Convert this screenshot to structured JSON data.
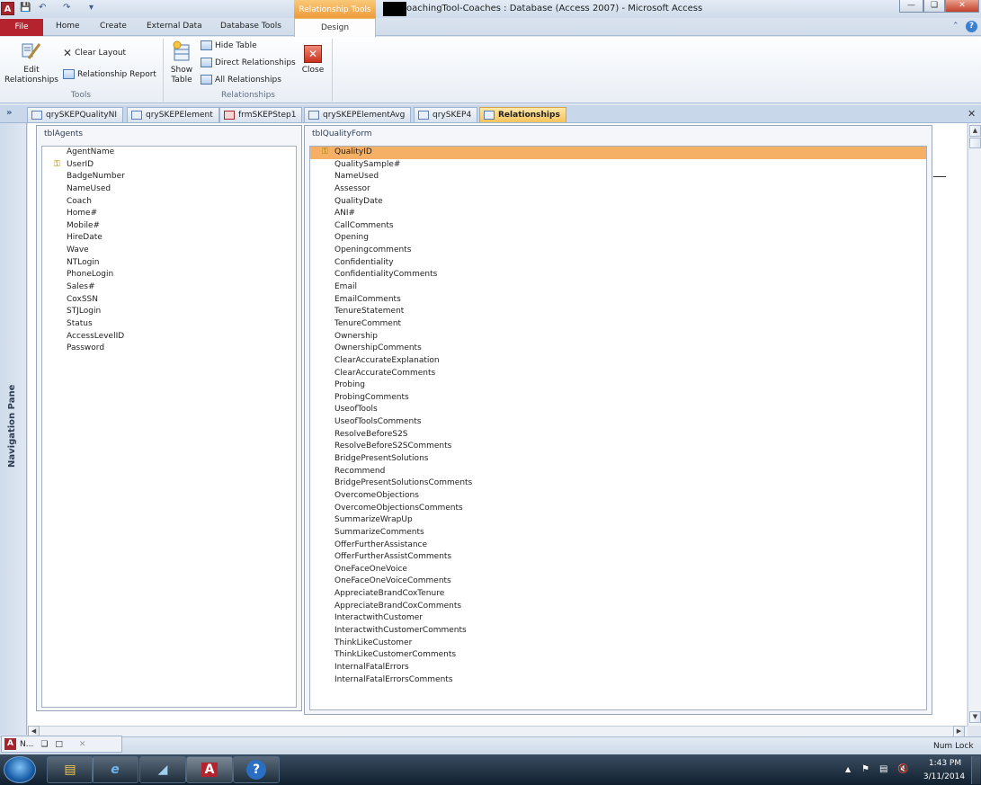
{
  "window": {
    "title": "oachingTool-Coaches : Database (Access 2007)  -  Microsoft Access",
    "context_tab_header": "Relationship Tools"
  },
  "ribbon_tabs": {
    "file": "File",
    "home": "Home",
    "create": "Create",
    "external_data": "External Data",
    "database_tools": "Database Tools",
    "design": "Design"
  },
  "ribbon": {
    "tools_group": {
      "label": "Tools",
      "edit_relationships": "Edit\nRelationships",
      "clear_layout": "Clear Layout",
      "relationship_report": "Relationship Report"
    },
    "relationships_group": {
      "label": "Relationships",
      "show_table": "Show\nTable",
      "hide_table": "Hide Table",
      "direct_relationships": "Direct Relationships",
      "all_relationships": "All Relationships",
      "close": "Close"
    }
  },
  "document_tabs": [
    {
      "label": "qrySKEPQualityNI",
      "icon": "query-icon"
    },
    {
      "label": "qrySKEPElement",
      "icon": "query-icon"
    },
    {
      "label": "frmSKEPStep1",
      "icon": "form-icon"
    },
    {
      "label": "qrySKEPElementAvg",
      "icon": "query-icon"
    },
    {
      "label": "qrySKEP4",
      "icon": "query-icon"
    },
    {
      "label": "Relationships",
      "icon": "relationships-icon",
      "active": true
    }
  ],
  "nav_pane": {
    "label": "Navigation Pane",
    "toggle": "»"
  },
  "tables": {
    "agents": {
      "name": "tblAgents",
      "fields": [
        "AgentName",
        "UserID",
        "BadgeNumber",
        "NameUsed",
        "Coach",
        "Home#",
        "Mobile#",
        "HireDate",
        "Wave",
        "NTLogin",
        "PhoneLogin",
        "Sales#",
        "CoxSSN",
        "STJLogin",
        "Status",
        "AccessLevelID",
        "Password"
      ],
      "key_field": "UserID"
    },
    "quality_form": {
      "name": "tblQualityForm",
      "fields": [
        "QualityID",
        "QualitySample#",
        "NameUsed",
        "Assessor",
        "QualityDate",
        "ANI#",
        "CallComments",
        "Opening",
        "Openingcomments",
        "Confidentiality",
        "ConfidentialityComments",
        "Email",
        "EmailComments",
        "TenureStatement",
        "TenureComment",
        "Ownership",
        "OwnershipComments",
        "ClearAccurateExplanation",
        "ClearAccurateComments",
        "Probing",
        "ProbingComments",
        "UseofTools",
        "UseofToolsComments",
        "ResolveBeforeS2S",
        "ResolveBeforeS2SComments",
        "BridgePresentSolutions",
        "Recommend",
        "BridgePresentSolutionsComments",
        "OvercomeObjections",
        "OvercomeObjectionsComments",
        "SummarizeWrapUp",
        "SummarizeComments",
        "OfferFurtherAssistance",
        "OfferFurtherAssistComments",
        "OneFaceOneVoice",
        "OneFaceOneVoiceComments",
        "AppreciateBrandCoxTenure",
        "AppreciateBrandCoxComments",
        "InteractwithCustomer",
        "InteractwithCustomerComments",
        "ThinkLikeCustomer",
        "ThinkLikeCustomerComments",
        "InternalFatalErrors",
        "InternalFatalErrorsComments"
      ],
      "key_field": "QualityID",
      "selected_field": "QualityID"
    }
  },
  "status_bar": {
    "minimized_window": "N...",
    "num_lock": "Num Lock"
  },
  "taskbar": {
    "time": "1:43 PM",
    "date": "3/11/2014"
  },
  "colors": {
    "file_tab": "#b5232f",
    "context_tab": "#ee9b3b",
    "selected_field": "#f6b066",
    "taskbar": "#10202f"
  }
}
